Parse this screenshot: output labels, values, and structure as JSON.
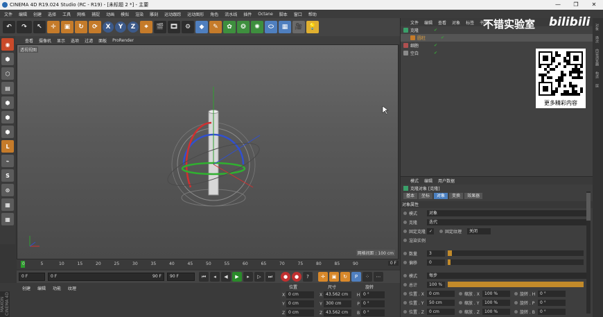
{
  "window": {
    "title": "CINEMA 4D R19.024 Studio (RC - R19) - [未标题 2 *] - 主要"
  },
  "menubar": [
    "文件",
    "编辑",
    "创建",
    "选择",
    "工具",
    "网格",
    "捕捉",
    "动画",
    "模拟",
    "渲染",
    "雕刻",
    "运动跟踪",
    "运动图形",
    "角色",
    "流水线",
    "插件",
    "Octane",
    "脚本",
    "窗口",
    "帮助"
  ],
  "toolbar": {
    "axis_labels": [
      "X",
      "Y",
      "Z"
    ]
  },
  "viewport": {
    "menu": [
      "查看",
      "摄像机",
      "显示",
      "选项",
      "过滤",
      "面板",
      "ProRender"
    ],
    "label": "透视视图",
    "grid_spacing": "网格间距 : 100 cm",
    "axis_colors": {
      "x": "#d03030",
      "y": "#30a030",
      "z": "#3050d0"
    }
  },
  "timeline": {
    "ticks": [
      "0",
      "5",
      "10",
      "15",
      "20",
      "25",
      "30",
      "35",
      "40",
      "45",
      "50",
      "55",
      "60",
      "65",
      "70",
      "75",
      "80",
      "85",
      "90"
    ],
    "end_frame": "0 F"
  },
  "playbar": {
    "start": "0 F",
    "range": "0 F",
    "range_end": "90 F",
    "end": "90 F"
  },
  "material": {
    "menu": [
      "创建",
      "编辑",
      "功能",
      "纹理"
    ]
  },
  "maxon_label": "MAXON CINEMA 4D",
  "coordinates": {
    "headers": [
      "位置",
      "尺寸",
      "旋转"
    ],
    "rows": [
      {
        "axis": "X",
        "pos": "0 cm",
        "size": "43.562 cm",
        "rot_label": "H",
        "rot": "0 °"
      },
      {
        "axis": "Y",
        "pos": "0 cm",
        "size": "300 cm",
        "rot_label": "P",
        "rot": "0 °"
      },
      {
        "axis": "Z",
        "pos": "0 cm",
        "size": "43.562 cm",
        "rot_label": "B",
        "rot": "0 °"
      }
    ]
  },
  "objects": {
    "tabs": [
      "文件",
      "编辑",
      "查看",
      "对象",
      "标签",
      "书签"
    ],
    "items": [
      {
        "name": "克隆",
        "color": "#3aa06a",
        "indent": 0,
        "selected": false
      },
      {
        "name": "圆柱",
        "color": "#c57b2a",
        "indent": 1,
        "selected": true
      },
      {
        "name": "细胞",
        "color": "#b05050",
        "indent": 0,
        "selected": false
      },
      {
        "name": "空白",
        "color": "#8a8a8a",
        "indent": 0,
        "selected": false
      }
    ]
  },
  "watermark": {
    "text": "不错实验室",
    "brand": "bilibili",
    "qr_caption": "更多精彩内容"
  },
  "side_tabs": [
    "对象",
    "场次",
    "内容浏览器",
    "构造",
    "层"
  ],
  "attributes": {
    "top_menu": [
      "模式",
      "编辑",
      "用户数据"
    ],
    "title": "克隆对象 [克隆]",
    "tabs": [
      "基本",
      "坐标",
      "对象",
      "变换",
      "效果器"
    ],
    "active_tab": "对象",
    "section": "对象属性",
    "rows": [
      {
        "label": "模式",
        "value": "对象"
      },
      {
        "label": "克隆",
        "value": "迭代"
      },
      {
        "label": "固定克隆",
        "value": "✓",
        "extra_label": "固定纹理",
        "extra_value": "关闭"
      },
      {
        "label": "渲染实例",
        "value": ""
      }
    ],
    "count": {
      "label": "数量",
      "value": "3",
      "fill": 0.03
    },
    "offset": {
      "label": "偏移",
      "value": "0",
      "fill": 0.0
    },
    "mode2": {
      "label": "模式",
      "value": "每步"
    },
    "total": {
      "label": "总计",
      "value": "100 %",
      "fill": 1.0
    },
    "xform_rows": [
      {
        "l1": "位置 . X",
        "v1": "0 cm",
        "l2": "缩放 . X",
        "v2": "100 %",
        "l3": "旋转 . H",
        "v3": "0 °"
      },
      {
        "l1": "位置 . Y",
        "v1": "50 cm",
        "l2": "缩放 . Y",
        "v2": "100 %",
        "l3": "旋转 . P",
        "v3": "0 °"
      },
      {
        "l1": "位置 . Z",
        "v1": "0 cm",
        "l2": "缩放 . Z",
        "v2": "100 %",
        "l3": "旋转 . B",
        "v3": "0 °"
      }
    ]
  }
}
